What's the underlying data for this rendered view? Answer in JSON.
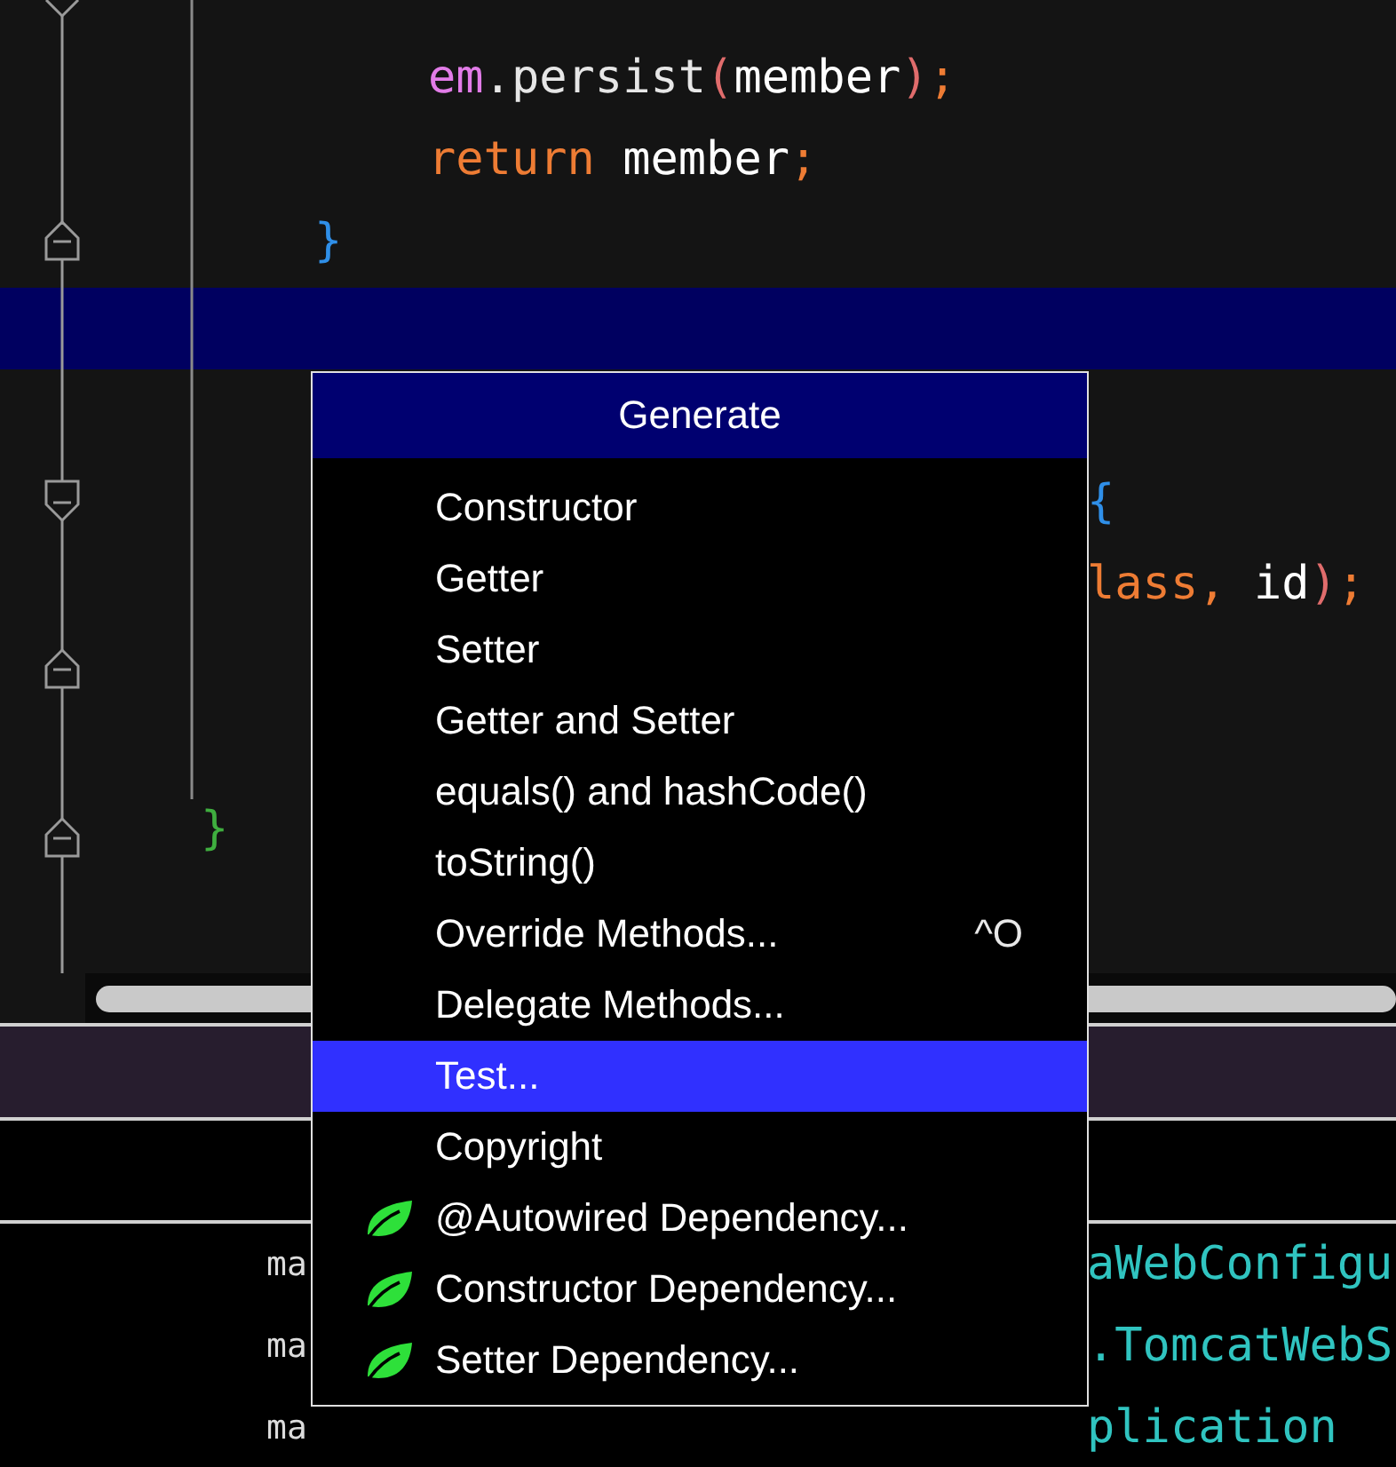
{
  "editor": {
    "lines": [
      {
        "kind": "inner",
        "tokens": [
          {
            "text": "em",
            "color": "#e27ce8"
          },
          {
            "text": ".persist",
            "color": "#e6e6e6"
          },
          {
            "text": "(",
            "color": "#e06c6c"
          },
          {
            "text": "member",
            "color": "#ffffff"
          },
          {
            "text": ")",
            "color": "#e06c6c"
          },
          {
            "text": ";",
            "color": "#ee7c34"
          }
        ]
      },
      {
        "kind": "inner",
        "tokens": [
          {
            "text": "return",
            "color": "#ee7c34"
          },
          {
            "text": " member",
            "color": "#ffffff"
          },
          {
            "text": ";",
            "color": "#ee7c34"
          }
        ]
      },
      {
        "kind": "outer",
        "tokens": [
          {
            "text": "}",
            "color": "#2f8fe8"
          }
        ]
      }
    ],
    "lower_lines": [
      {
        "kind": "covered",
        "tokens": [
          {
            "text": "{",
            "color": "#2f8fe8"
          }
        ]
      },
      {
        "kind": "covered",
        "tokens": [
          {
            "text": "lass",
            "color": "#ee7c34"
          },
          {
            "text": ", ",
            "color": "#ee7c34"
          },
          {
            "text": "id",
            "color": "#ffffff"
          },
          {
            "text": ")",
            "color": "#e06c6c"
          },
          {
            "text": ";",
            "color": "#ee7c34"
          }
        ]
      },
      {
        "kind": "blank"
      },
      {
        "kind": "blank"
      },
      {
        "kind": "class_end",
        "tokens": [
          {
            "text": "}",
            "color": "#3fae3f"
          }
        ]
      }
    ]
  },
  "console": {
    "rows": [
      {
        "left": "ma",
        "right": "aWebConfigu"
      },
      {
        "left": "ma",
        "right": ".TomcatWebS"
      },
      {
        "left": "ma",
        "right": "plication"
      }
    ]
  },
  "popup": {
    "title": "Generate",
    "items": [
      {
        "kind": "plain",
        "label": "Constructor",
        "selected": false
      },
      {
        "kind": "plain",
        "label": "Getter",
        "selected": false
      },
      {
        "kind": "plain",
        "label": "Setter",
        "selected": false
      },
      {
        "kind": "plain",
        "label": "Getter and Setter",
        "selected": false
      },
      {
        "kind": "plain",
        "label": "equals() and hashCode()",
        "selected": false
      },
      {
        "kind": "plain",
        "label": "toString()",
        "selected": false
      },
      {
        "kind": "plain",
        "label": "Override Methods...",
        "selected": false,
        "shortcut": "^O"
      },
      {
        "kind": "plain",
        "label": "Delegate Methods...",
        "selected": false
      },
      {
        "kind": "plain",
        "label": "Test...",
        "selected": true
      },
      {
        "kind": "plain",
        "label": "Copyright",
        "selected": false
      },
      {
        "kind": "dependency",
        "label": "@Autowired Dependency...",
        "selected": false
      },
      {
        "kind": "dependency",
        "label": "Constructor Dependency...",
        "selected": false
      },
      {
        "kind": "dependency",
        "label": "Setter Dependency...",
        "selected": false
      }
    ]
  }
}
